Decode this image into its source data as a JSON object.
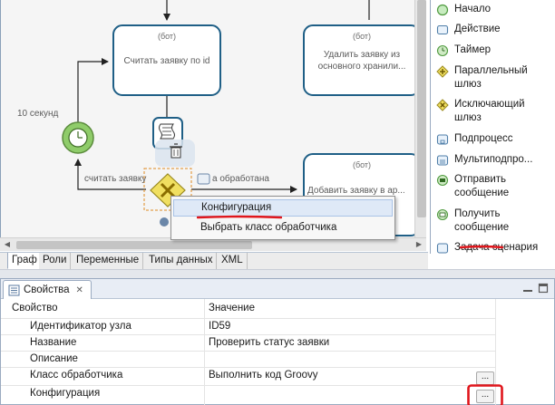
{
  "diagram": {
    "nodes": [
      {
        "id": "task1",
        "title": "(бот)",
        "text": "Считать заявку по id"
      },
      {
        "id": "task2",
        "title": "(бот)",
        "text": "Удалить заявку из\nосновного хранили..."
      },
      {
        "id": "task3",
        "title": "(бот)",
        "text": "Добавить заявку в ар..."
      }
    ],
    "timer_label": "10 секунд",
    "flow_label_read": "считать заявку",
    "flow_label_processed": "а обработана"
  },
  "palette": {
    "items": [
      {
        "label": "Начало",
        "icon": "start-event-icon"
      },
      {
        "label": "Действие",
        "icon": "task-icon"
      },
      {
        "label": "Таймер",
        "icon": "timer-icon"
      },
      {
        "label": "Параллельный\nшлюз",
        "icon": "parallel-gateway-icon"
      },
      {
        "label": "Исключающий\nшлюз",
        "icon": "exclusive-gateway-icon"
      },
      {
        "label": "Подпроцесс",
        "icon": "subprocess-icon"
      },
      {
        "label": "Мультиподпро...",
        "icon": "multi-subprocess-icon"
      },
      {
        "label": "Отправить\nсообщение",
        "icon": "send-message-icon"
      },
      {
        "label": "Получить\nсообщение",
        "icon": "receive-message-icon"
      },
      {
        "label": "Задача сценария",
        "icon": "script-task-icon"
      }
    ]
  },
  "editor_tabs": [
    {
      "label": "Граф",
      "active": true
    },
    {
      "label": "Роли",
      "active": false
    },
    {
      "label": "Переменные",
      "active": false
    },
    {
      "label": "Типы данных",
      "active": false
    },
    {
      "label": "XML",
      "active": false
    }
  ],
  "properties": {
    "tab_label": "Свойства",
    "col_property": "Свойство",
    "col_value": "Значение",
    "rows": [
      {
        "name": "Идентификатор узла",
        "value": "ID59"
      },
      {
        "name": "Название",
        "value": "Проверить статус заявки"
      },
      {
        "name": "Описание",
        "value": ""
      },
      {
        "name": "Класс обработчика",
        "value": "Выполнить код Groovy"
      },
      {
        "name": "Конфигурация",
        "value": ""
      }
    ],
    "edit_button_label": "..."
  },
  "context_menu": {
    "items": [
      {
        "label": "Конфигурация",
        "highlighted": true
      },
      {
        "label": "Выбрать класс обработчика",
        "highlighted": false
      }
    ]
  },
  "colors": {
    "node_border": "#1f5f86",
    "annotation_red": "#e0161c",
    "timer_green": "#8fcc6a",
    "gateway_yellow": "#f0df60",
    "menu_highlight": "#dfe9f7"
  }
}
